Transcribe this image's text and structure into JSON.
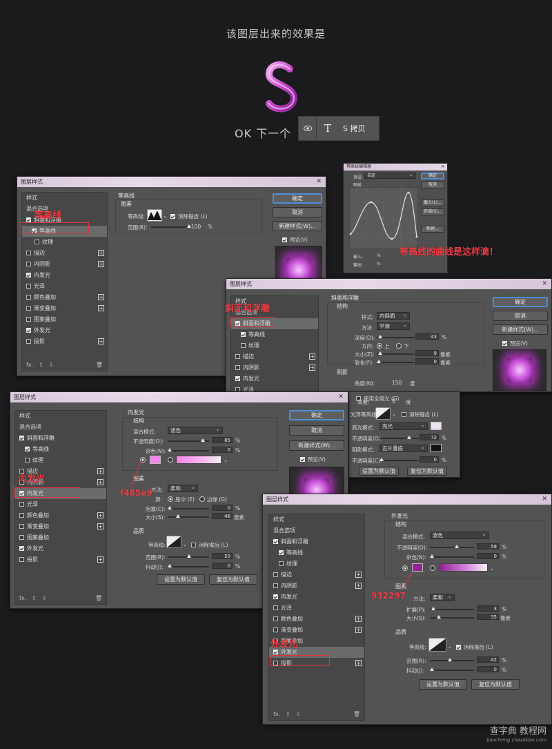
{
  "header": {
    "heading": "该图层出来的效果是",
    "s_letter": "S",
    "ok_text": "OK 下一个",
    "layer": {
      "icon": "eye-icon",
      "type_glyph": "T",
      "name": "S 拷贝"
    }
  },
  "accent_colors": {
    "pink": "#f485e9",
    "purple": "#932297",
    "red_annotation": "#e0343c",
    "button_focus": "#4f8ed9"
  },
  "common": {
    "ok": "确定",
    "cancel": "取消",
    "new_style": "新建样式(W)...",
    "preview": "预览(V)",
    "set_default": "设置为默认值",
    "reset_default": "复位为默认值",
    "fx": "fx.",
    "up": "⇧",
    "down": "⇩",
    "trash": "🗑"
  },
  "dialog1": {
    "title": "图层样式",
    "sidebar": [
      "样式",
      "混合选项",
      "斜面和浮雕",
      "等高线",
      "纹理",
      "描边",
      "内阴影",
      "内发光",
      "光泽",
      "颜色叠加",
      "渐变叠加",
      "图案叠加",
      "外发光",
      "投影"
    ],
    "section": "等高线",
    "group": "图素",
    "contour_label": "等高线:",
    "anti_alias": "消除锯齿 (L)",
    "range_label": "范围(R):",
    "range_value": "100",
    "unit": "%",
    "annotation": "等高线"
  },
  "curve_dialog": {
    "title": "等高线编辑器",
    "preset_label": "预设:",
    "preset_value": "自定",
    "mapping": "映射",
    "ok": "确定",
    "cancel": "取消",
    "load": "载入(L)...",
    "save": "存储(S)...",
    "new": "新建...",
    "input": "输入:",
    "output": "输出:",
    "unit": "%",
    "annotation": "等高线的曲线是这样滴！"
  },
  "dialog2": {
    "title": "图层样式",
    "sidebar": [
      "样式",
      "混合选项",
      "斜面和浮雕",
      "等高线",
      "纹理",
      "描边",
      "内阴影",
      "内发光",
      "光泽"
    ],
    "section": "斜面和浮雕",
    "structure": "结构",
    "style_label": "样式:",
    "style_value": "内斜面",
    "method_label": "方法:",
    "method_value": "平滑",
    "depth_label": "深度(D):",
    "depth_value": "43",
    "direction_label": "方向:",
    "dir_up": "上",
    "dir_down": "下",
    "size_label": "大小(Z):",
    "size_value": "9",
    "soften_label": "软化(F):",
    "soften_value": "0",
    "unit_pct": "%",
    "unit_px": "像素",
    "shading": "阴影",
    "angle_label": "角度(N):",
    "angle_value": "150",
    "degree": "度",
    "global_light": "使用全局光 (G)",
    "altitude_label": "高度:",
    "altitude_value": "5",
    "gloss_label": "光泽等高线:",
    "anti_alias": "消除锯齿 (L)",
    "highlight_label": "高光模式:",
    "highlight_value": "亮光",
    "hl_opacity_label": "不透明度(O):",
    "hl_opacity_value": "72",
    "shadow_label": "阴影模式:",
    "shadow_value": "正片叠底",
    "sh_opacity_label": "不透明度(C):",
    "sh_opacity_value": "0",
    "annotation": "斜面和浮雕"
  },
  "dialog3": {
    "title": "图层样式",
    "sidebar": [
      "样式",
      "混合选项",
      "斜面和浮雕",
      "等高线",
      "纹理",
      "描边",
      "内阴影",
      "内发光",
      "光泽",
      "颜色叠加",
      "渐变叠加",
      "图案叠加",
      "外发光",
      "投影"
    ],
    "section": "内发光",
    "structure": "结构",
    "blend_label": "混合模式:",
    "blend_value": "滤色",
    "opacity_label": "不透明度(O):",
    "opacity_value": "85",
    "noise_label": "杂色(N):",
    "noise_value": "0",
    "elements": "图素",
    "method_label": "方法:",
    "method_value": "柔和",
    "source_label": "源:",
    "center": "居中 (E)",
    "edge": "边缘 (G)",
    "choke_label": "阻塞(C):",
    "choke_value": "0",
    "size_label": "大小(S):",
    "size_value": "46",
    "quality": "品质",
    "contour_label": "等高线:",
    "anti_alias": "消除锯齿 (L)",
    "range_label": "范围(R):",
    "range_value": "50",
    "jitter_label": "抖动(J):",
    "jitter_value": "0",
    "unit_pct": "%",
    "unit_px": "像素",
    "annotation": "内发光",
    "color_annotation": "f485e9"
  },
  "dialog4": {
    "title": "图层样式",
    "sidebar": [
      "样式",
      "混合选项",
      "斜面和浮雕",
      "等高线",
      "纹理",
      "描边",
      "内阴影",
      "内发光",
      "光泽",
      "颜色叠加",
      "渐变叠加",
      "图案叠加",
      "外发光",
      "投影"
    ],
    "section": "外发光",
    "structure": "结构",
    "blend_label": "混合模式:",
    "blend_value": "滤色",
    "opacity_label": "不透明度(O):",
    "opacity_value": "59",
    "noise_label": "杂色(N):",
    "noise_value": "0",
    "elements": "图素",
    "method_label": "方法:",
    "method_value": "柔和",
    "spread_label": "扩展(P):",
    "spread_value": "3",
    "size_label": "大小(S):",
    "size_value": "35",
    "quality": "品质",
    "contour_label": "等高线:",
    "anti_alias": "消除锯齿 (L)",
    "range_label": "范围(R):",
    "range_value": "42",
    "jitter_label": "抖动(J):",
    "jitter_value": "0",
    "unit_pct": "%",
    "unit_px": "像素",
    "annotation": "外发光",
    "color_annotation": "932297"
  },
  "watermark": {
    "main": "查字典 教程网",
    "sub": "jiaocheng.chazidian.com"
  }
}
